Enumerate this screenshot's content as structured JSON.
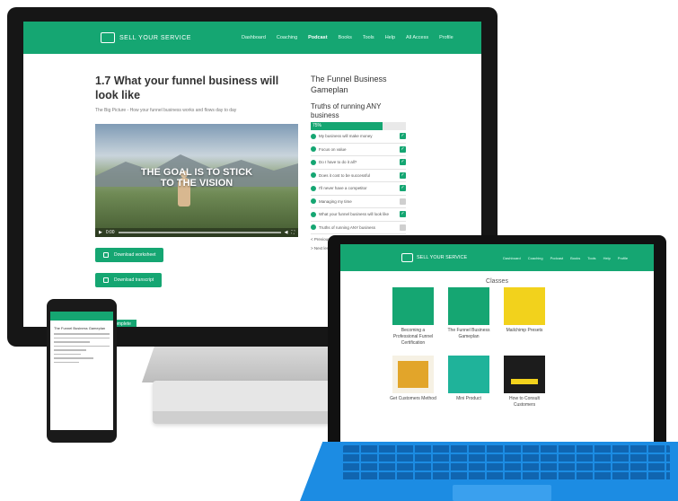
{
  "monitor": {
    "nav": {
      "logo": "SELL YOUR SERVICE",
      "menu": [
        {
          "label": "Dashboard",
          "active": false
        },
        {
          "label": "Coaching",
          "active": false
        },
        {
          "label": "Podcast",
          "active": true
        },
        {
          "label": "Books",
          "active": false
        },
        {
          "label": "Tools",
          "active": false
        },
        {
          "label": "Help",
          "active": false
        },
        {
          "label": "All Access",
          "active": false
        },
        {
          "label": "Profile",
          "active": false
        }
      ]
    },
    "lesson_title": "1.7 What your funnel business will look like",
    "lesson_subtitle": "The Big Picture - How your funnel business works and flows day to day",
    "video": {
      "overlay_line1": "THE GOAL IS TO STICK",
      "overlay_line2": "TO THE VISION",
      "time": "0:00",
      "fullscreen_icon": "fullscreen-icon"
    },
    "buttons": {
      "download": "Download worksheet",
      "download2": "Download transcript",
      "complete": "Mark Complete"
    },
    "sidebar": {
      "course_title": "The Funnel Business Gameplan",
      "section_title": "Truths of running ANY business",
      "progress_percent": 75,
      "progress_label": "75%",
      "lessons": [
        {
          "label": "My business will make money",
          "done": true
        },
        {
          "label": "Focus on value",
          "done": true
        },
        {
          "label": "Do I have to do it all?",
          "done": true
        },
        {
          "label": "Does it cost to be successful",
          "done": true
        },
        {
          "label": "I'll never have a competitor",
          "done": true
        },
        {
          "label": "Managing my time",
          "done": false
        },
        {
          "label": "What your funnel business will look like",
          "done": true
        },
        {
          "label": "Truths of running ANY business",
          "done": false
        }
      ],
      "footer_links": [
        "< Previous lesson",
        "> Next lesson"
      ]
    }
  },
  "tablet": {
    "nav": {
      "logo": "SELL YOUR SERVICE",
      "menu": [
        "Dashboard",
        "Coaching",
        "Podcast",
        "Books",
        "Tools",
        "Help",
        "Profile"
      ]
    },
    "heading": "Classes",
    "cards": [
      {
        "label": "Becoming a Professional Funnel Certification",
        "color": "green"
      },
      {
        "label": "The Funnel Business Gameplan",
        "color": "green"
      },
      {
        "label": "Mailchimp Presets",
        "color": "yellow"
      },
      {
        "label": "Get Customers Method",
        "color": "gold"
      },
      {
        "label": "Mini Product",
        "color": "teal"
      },
      {
        "label": "How to Consult Customers",
        "color": "dark"
      }
    ]
  },
  "phone": {
    "title": "The Funnel Business Gameplan"
  },
  "colors": {
    "brand_green": "#15a672",
    "keyboard_blue": "#1c8ce3"
  }
}
